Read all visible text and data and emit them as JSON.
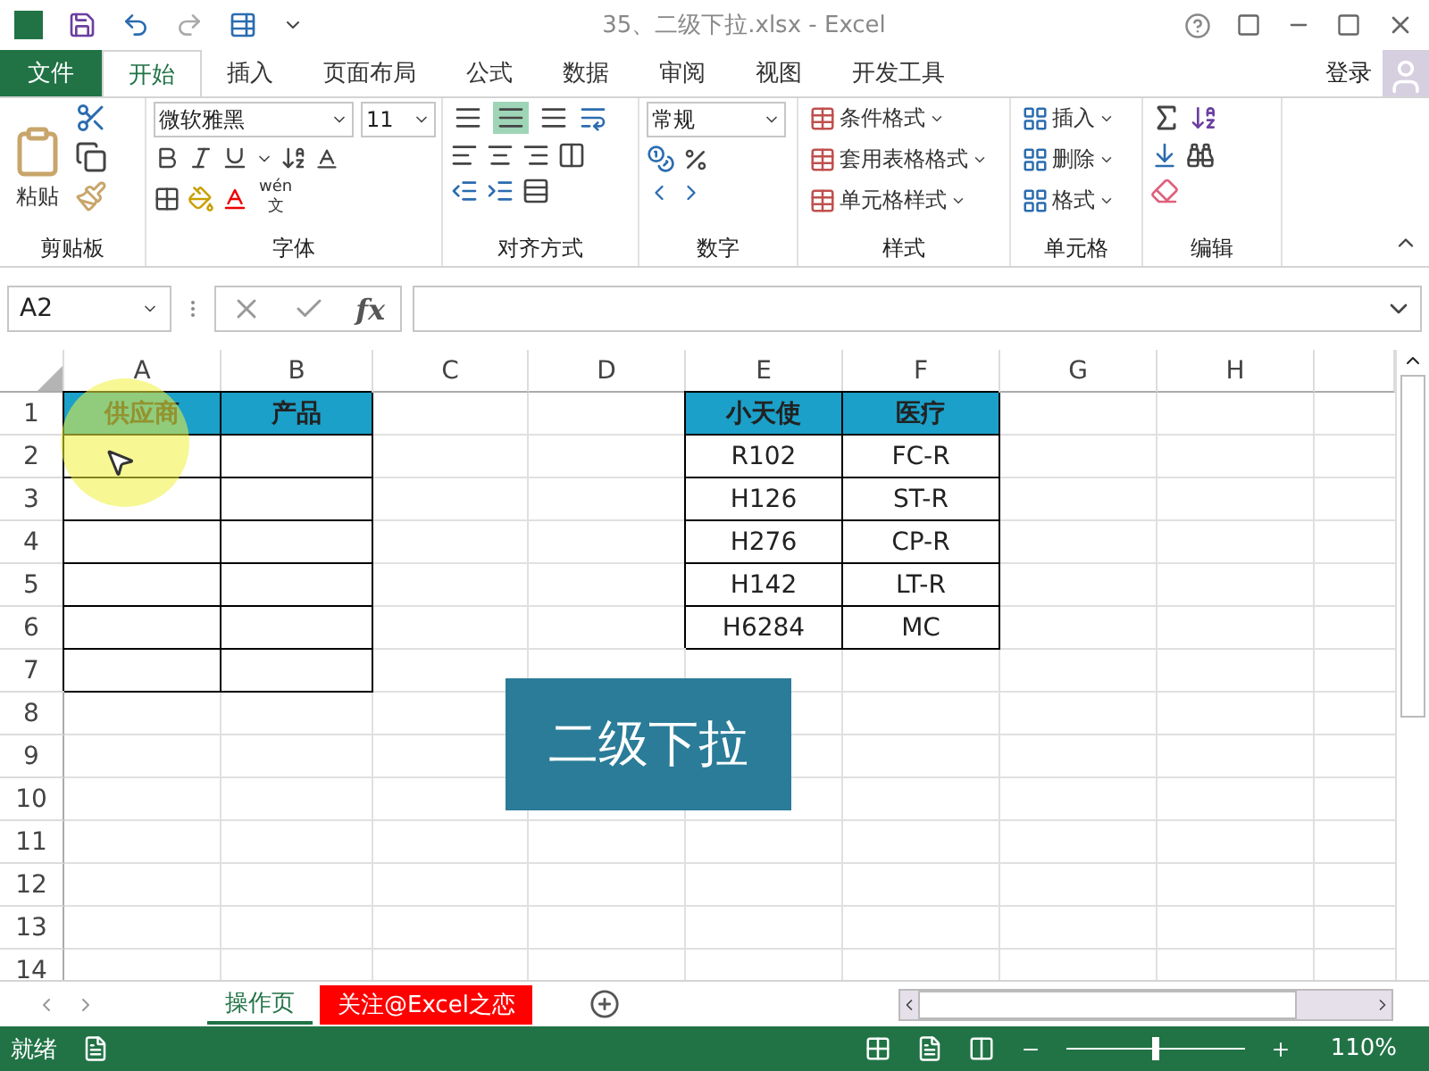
{
  "title_bar": {
    "title": "35、二级下拉.xlsx - Excel"
  },
  "menu_tabs": [
    {
      "label": "文件",
      "kind": "file",
      "selected": false
    },
    {
      "label": "开始",
      "kind": "tab",
      "selected": true
    },
    {
      "label": "插入",
      "kind": "tab",
      "selected": false
    },
    {
      "label": "页面布局",
      "kind": "tab",
      "selected": false
    },
    {
      "label": "公式",
      "kind": "tab",
      "selected": false
    },
    {
      "label": "数据",
      "kind": "tab",
      "selected": false
    },
    {
      "label": "审阅",
      "kind": "tab",
      "selected": false
    },
    {
      "label": "视图",
      "kind": "tab",
      "selected": false
    },
    {
      "label": "开发工具",
      "kind": "tab",
      "selected": false
    }
  ],
  "account": {
    "label": "登录"
  },
  "ribbon": {
    "clipboard": {
      "label": "剪贴板",
      "paste": "粘贴"
    },
    "font": {
      "label": "字体",
      "font_name": "微软雅黑",
      "font_size": "11",
      "phonetic": "wén",
      "phonetic_char": "文"
    },
    "alignment": {
      "label": "对齐方式",
      "vertical_buttons": [
        {
          "selected": false
        },
        {
          "selected": true
        },
        {
          "selected": false
        }
      ]
    },
    "number": {
      "label": "数字",
      "format": "常规"
    },
    "styles": {
      "label": "样式",
      "items": [
        "条件格式",
        "套用表格格式",
        "单元格样式"
      ]
    },
    "cells": {
      "label": "单元格",
      "items": [
        "插入",
        "删除",
        "格式"
      ]
    },
    "editing": {
      "label": "编辑"
    }
  },
  "formula_bar": {
    "name_box": "A2",
    "fx": "fx"
  },
  "grid": {
    "columns": [
      "A",
      "B",
      "C",
      "D",
      "E",
      "F",
      "G",
      "H"
    ],
    "rows": [
      {
        "label": "1",
        "cells": [
          {
            "text": "供应商",
            "kind": "header"
          },
          {
            "text": "产品",
            "kind": "header"
          },
          {
            "kind": "plain"
          },
          {
            "kind": "plain"
          },
          {
            "text": "小天使",
            "kind": "header"
          },
          {
            "text": "医疗",
            "kind": "header"
          },
          {
            "kind": "plain"
          },
          {
            "kind": "plain"
          }
        ]
      },
      {
        "label": "2",
        "cells": [
          {
            "kind": "bordered"
          },
          {
            "kind": "bordered"
          },
          {
            "kind": "plain"
          },
          {
            "kind": "plain"
          },
          {
            "text": "R102",
            "kind": "bordered"
          },
          {
            "text": "FC-R",
            "kind": "bordered"
          },
          {
            "kind": "plain"
          },
          {
            "kind": "plain"
          }
        ]
      },
      {
        "label": "3",
        "cells": [
          {
            "kind": "bordered"
          },
          {
            "kind": "bordered"
          },
          {
            "kind": "plain"
          },
          {
            "kind": "plain"
          },
          {
            "text": "H126",
            "kind": "bordered"
          },
          {
            "text": "ST-R",
            "kind": "bordered"
          },
          {
            "kind": "plain"
          },
          {
            "kind": "plain"
          }
        ]
      },
      {
        "label": "4",
        "cells": [
          {
            "kind": "bordered"
          },
          {
            "kind": "bordered"
          },
          {
            "kind": "plain"
          },
          {
            "kind": "plain"
          },
          {
            "text": "H276",
            "kind": "bordered"
          },
          {
            "text": "CP-R",
            "kind": "bordered"
          },
          {
            "kind": "plain"
          },
          {
            "kind": "plain"
          }
        ]
      },
      {
        "label": "5",
        "cells": [
          {
            "kind": "bordered"
          },
          {
            "kind": "bordered"
          },
          {
            "kind": "plain"
          },
          {
            "kind": "plain"
          },
          {
            "text": "H142",
            "kind": "bordered"
          },
          {
            "text": "LT-R",
            "kind": "bordered"
          },
          {
            "kind": "plain"
          },
          {
            "kind": "plain"
          }
        ]
      },
      {
        "label": "6",
        "cells": [
          {
            "kind": "bordered"
          },
          {
            "kind": "bordered"
          },
          {
            "kind": "plain"
          },
          {
            "kind": "plain"
          },
          {
            "text": "H6284",
            "kind": "bordered"
          },
          {
            "text": "MC",
            "kind": "bordered"
          },
          {
            "kind": "plain"
          },
          {
            "kind": "plain"
          }
        ]
      },
      {
        "label": "7",
        "cells": [
          {
            "kind": "bordered"
          },
          {
            "kind": "bordered"
          }
        ]
      },
      {
        "label": "8"
      },
      {
        "label": "9"
      },
      {
        "label": "10"
      },
      {
        "label": "11"
      },
      {
        "label": "12"
      },
      {
        "label": "13"
      },
      {
        "label": "14"
      }
    ]
  },
  "callout": {
    "text": "二级下拉"
  },
  "sheet_tabs": [
    {
      "label": "操作页",
      "selected": true
    },
    {
      "label": "关注@Excel之恋",
      "selected": false,
      "color": "#ff0000"
    }
  ],
  "status_bar": {
    "status": "就绪",
    "zoom": "110%",
    "zoom_slider": {
      "level": 0.5
    }
  }
}
